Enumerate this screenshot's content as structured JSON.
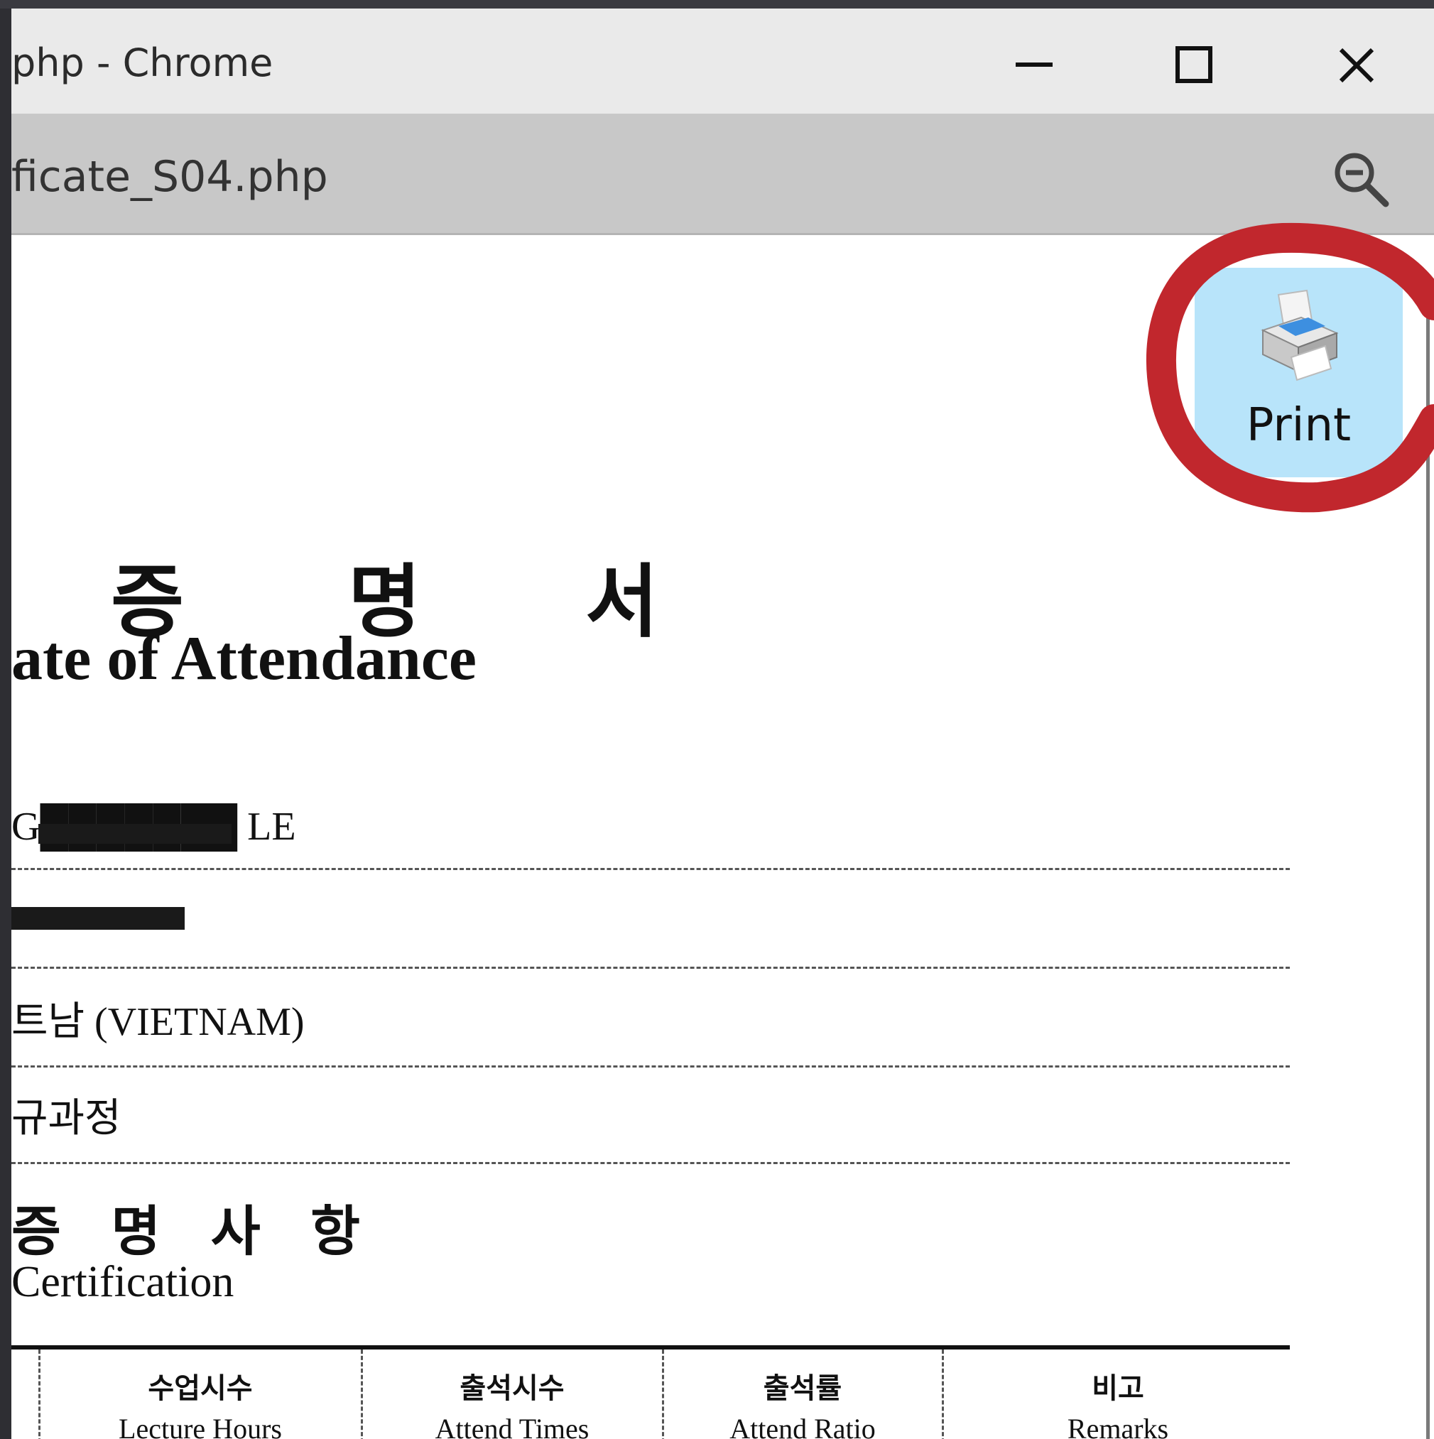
{
  "window": {
    "title": "php - Chrome",
    "minimize_icon": "minimize-icon",
    "maximize_icon": "maximize-icon",
    "close_icon": "close-icon"
  },
  "addressbar": {
    "url": "ficate_S04.php",
    "zoom_icon": "zoom-out-icon"
  },
  "toolbar": {
    "print_label": "Print",
    "print_icon": "printer-icon"
  },
  "annotation": {
    "color": "#c1272d"
  },
  "document": {
    "title_ko": "증 명 서",
    "title_en": "ate of Attendance",
    "fields": [
      {
        "value": "G███████ LE"
      },
      {
        "value": ""
      },
      {
        "value": "트남 (VIETNAM)"
      },
      {
        "value": "규과정"
      }
    ],
    "section_title_ko": "증 명 사 항",
    "section_title_en": "Certification",
    "table": {
      "columns": [
        {
          "ko": "수업시수",
          "en": "Lecture Hours"
        },
        {
          "ko": "출석시수",
          "en": "Attend Times"
        },
        {
          "ko": "출석률",
          "en": "Attend Ratio"
        },
        {
          "ko": "비고",
          "en": "Remarks"
        }
      ]
    }
  }
}
